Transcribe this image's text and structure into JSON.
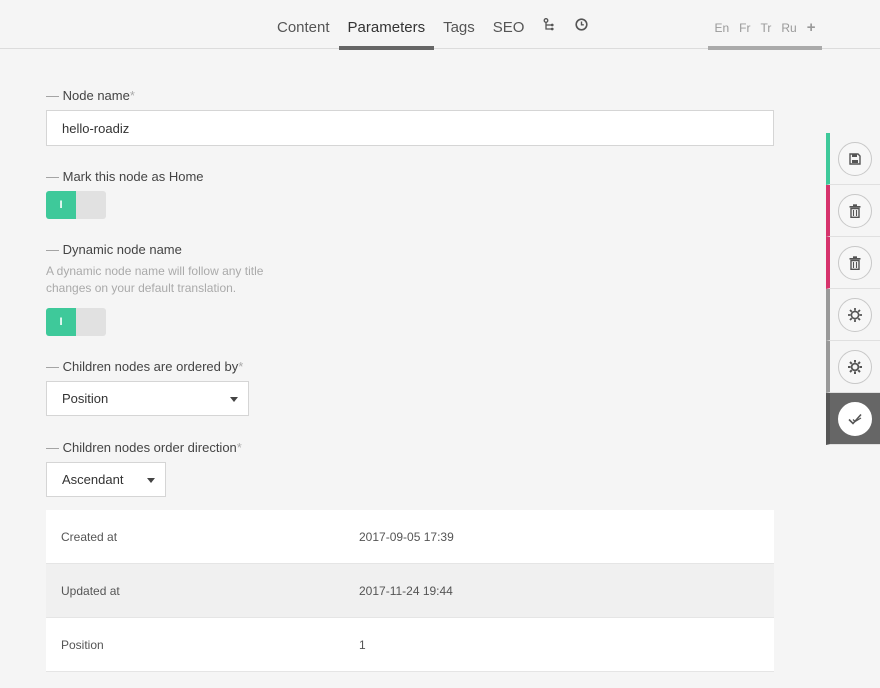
{
  "tabs": [
    {
      "label": "Content"
    },
    {
      "label": "Parameters"
    },
    {
      "label": "Tags"
    },
    {
      "label": "SEO"
    }
  ],
  "tab_icons": [
    "tree-icon",
    "clock-icon"
  ],
  "languages": [
    "En",
    "Fr",
    "Tr",
    "Ru",
    "+"
  ],
  "form": {
    "node_name": {
      "label": "Node name",
      "required": "*",
      "value": "hello-roadiz"
    },
    "mark_home": {
      "label": "Mark this node as Home",
      "toggle_text": "I",
      "checked": true
    },
    "dynamic_name": {
      "label": "Dynamic node name",
      "description": "A dynamic node name will follow any title changes on your default translation.",
      "toggle_text": "I",
      "checked": true
    },
    "children_order": {
      "label": "Children nodes are ordered by",
      "required": "*",
      "value": "Position"
    },
    "order_direction": {
      "label": "Children nodes order direction",
      "required": "*",
      "value": "Ascendant"
    }
  },
  "info_table": [
    {
      "key": "Created at",
      "value": "2017-09-05 17:39"
    },
    {
      "key": "Updated at",
      "value": "2017-11-24 19:44"
    },
    {
      "key": "Position",
      "value": "1"
    }
  ],
  "actions": [
    {
      "icon": "save-icon",
      "accent": "#3ec99a"
    },
    {
      "icon": "trash-icon",
      "accent": "#d6336c"
    },
    {
      "icon": "trash-icon",
      "accent": "#d6336c"
    },
    {
      "icon": "gear-refresh-icon",
      "accent": "#999999"
    },
    {
      "icon": "gear-icon",
      "accent": "#999999"
    },
    {
      "icon": "publish-check-icon",
      "accent": "#555555"
    }
  ],
  "colors": {
    "accent_green": "#3ec99a",
    "accent_red": "#d6336c"
  }
}
